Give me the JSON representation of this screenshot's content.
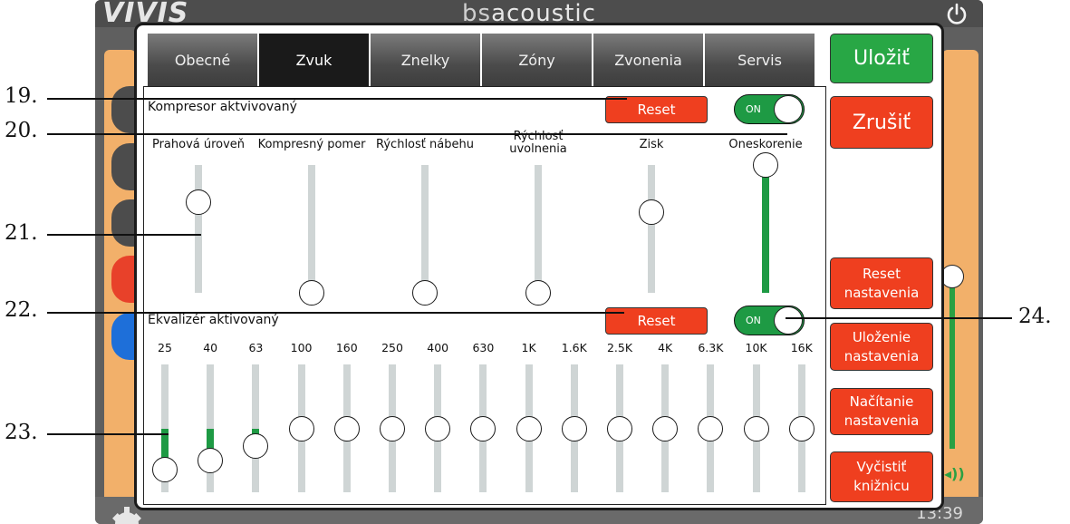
{
  "background": {
    "logo": "VIVIS",
    "brand_prefix": "bs",
    "brand_suffix": "acoustic",
    "time": "13:39"
  },
  "tabs": [
    {
      "label": "Obecné",
      "active": false
    },
    {
      "label": "Zvuk",
      "active": true
    },
    {
      "label": "Znelky",
      "active": false
    },
    {
      "label": "Zóny",
      "active": false
    },
    {
      "label": "Zvonenia",
      "active": false
    },
    {
      "label": "Servis",
      "active": false
    }
  ],
  "compressor": {
    "title": "Kompresor aktvivovaný",
    "reset_label": "Reset",
    "toggle_label": "ON",
    "toggle_on": true,
    "sliders": [
      {
        "label": "Prahová úroveň",
        "level": 0.71,
        "filled": false
      },
      {
        "label": "Kompresný pomer",
        "level": 0.0,
        "filled": false
      },
      {
        "label": "Rýchlosť nábehu",
        "level": 0.0,
        "filled": false
      },
      {
        "label": "Rýchlosť\nuvolnenia",
        "level": 0.0,
        "filled": false
      },
      {
        "label": "Zisk",
        "level": 0.63,
        "filled": false
      },
      {
        "label": "Oneskorenie",
        "level": 1.0,
        "filled": true
      }
    ]
  },
  "equalizer": {
    "title": "Ekvalizér aktivovaný",
    "reset_label": "Reset",
    "toggle_label": "ON",
    "toggle_on": true,
    "bands": [
      {
        "label": "25",
        "level": 0.18
      },
      {
        "label": "40",
        "level": 0.25
      },
      {
        "label": "63",
        "level": 0.36
      },
      {
        "label": "100",
        "level": 0.5
      },
      {
        "label": "160",
        "level": 0.5
      },
      {
        "label": "250",
        "level": 0.5
      },
      {
        "label": "400",
        "level": 0.5
      },
      {
        "label": "630",
        "level": 0.5
      },
      {
        "label": "1K",
        "level": 0.5
      },
      {
        "label": "1.6K",
        "level": 0.5
      },
      {
        "label": "2.5K",
        "level": 0.5
      },
      {
        "label": "4K",
        "level": 0.5
      },
      {
        "label": "6.3K",
        "level": 0.5
      },
      {
        "label": "10K",
        "level": 0.5
      },
      {
        "label": "16K",
        "level": 0.5
      }
    ]
  },
  "right_buttons": {
    "save": "Uložiť",
    "cancel": "Zrušiť",
    "reset_settings": [
      "Reset",
      "nastavenia"
    ],
    "save_settings": [
      "Uloženie",
      "nastavenia"
    ],
    "load_settings": [
      "Načítanie",
      "nastavenia"
    ],
    "clear_library": [
      "Vyčistiť",
      "knižnicu"
    ]
  },
  "callouts": [
    "19.",
    "20.",
    "21.",
    "22.",
    "23.",
    "24."
  ],
  "colors": {
    "accent_green": "#1e9a44",
    "button_red": "#ef3f1f",
    "save_green": "#28a745",
    "track_gray": "#cfd5d5",
    "tab_active": "#1a1a1a"
  }
}
